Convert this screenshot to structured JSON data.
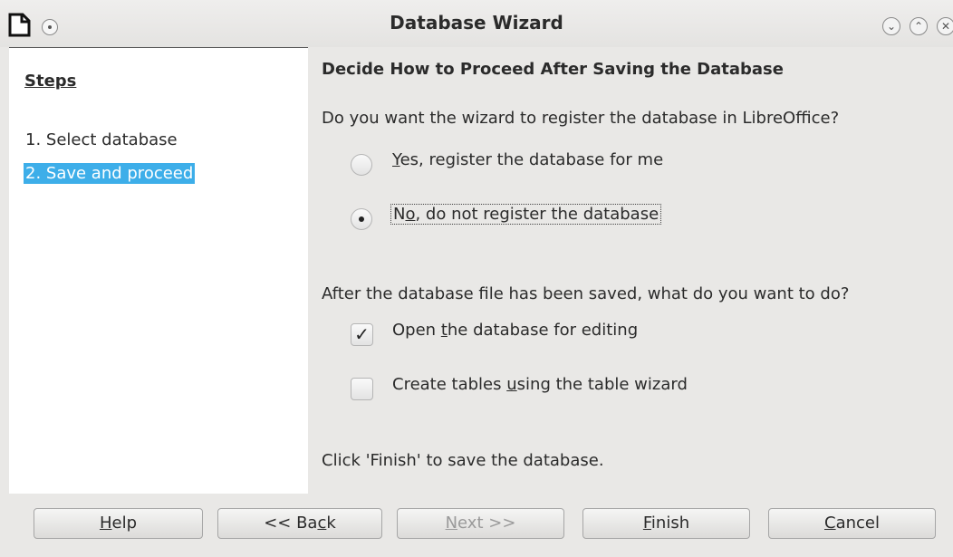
{
  "window": {
    "title": "Database Wizard"
  },
  "steps": {
    "heading": "Steps",
    "items": [
      "1. Select database",
      "2. Save and proceed"
    ],
    "active_index": 1
  },
  "page": {
    "title": "Decide How to Proceed After Saving the Database",
    "register_question": "Do you want the wizard to register the database in LibreOffice?",
    "register_options": [
      {
        "pre": "",
        "mnemonic": "Y",
        "post": "es, register the database for me",
        "selected": false
      },
      {
        "pre": "N",
        "mnemonic": "o",
        "post": ", do not register the database",
        "selected": true
      }
    ],
    "after_question": "After the database file has been saved, what do you want to do?",
    "after_options": [
      {
        "pre": "Open ",
        "mnemonic": "t",
        "post": "he database for editing",
        "checked": true
      },
      {
        "pre": "Create tables ",
        "mnemonic": "u",
        "post": "sing the table wizard",
        "checked": false
      }
    ],
    "finish_note": "Click 'Finish' to save the database."
  },
  "buttons": {
    "help": {
      "pre": "",
      "mnemonic": "H",
      "post": "elp",
      "enabled": true
    },
    "back": {
      "pre": "<< Ba",
      "mnemonic": "c",
      "post": "k",
      "enabled": true
    },
    "next": {
      "pre": "",
      "mnemonic": "N",
      "post": "ext >>",
      "enabled": false
    },
    "finish": {
      "pre": "",
      "mnemonic": "F",
      "post": "inish",
      "enabled": true
    },
    "cancel": {
      "pre": "",
      "mnemonic": "C",
      "post": "ancel",
      "enabled": true
    }
  },
  "icons": {
    "app": "libreoffice-document-icon",
    "window_menu": "window-menu-icon",
    "minimize": "minimize-icon",
    "maximize": "maximize-icon",
    "close": "close-icon",
    "check": "checkmark-icon"
  },
  "colors": {
    "selection": "#3daee9",
    "panel": "#ffffff",
    "background": "#e9e8e6"
  }
}
